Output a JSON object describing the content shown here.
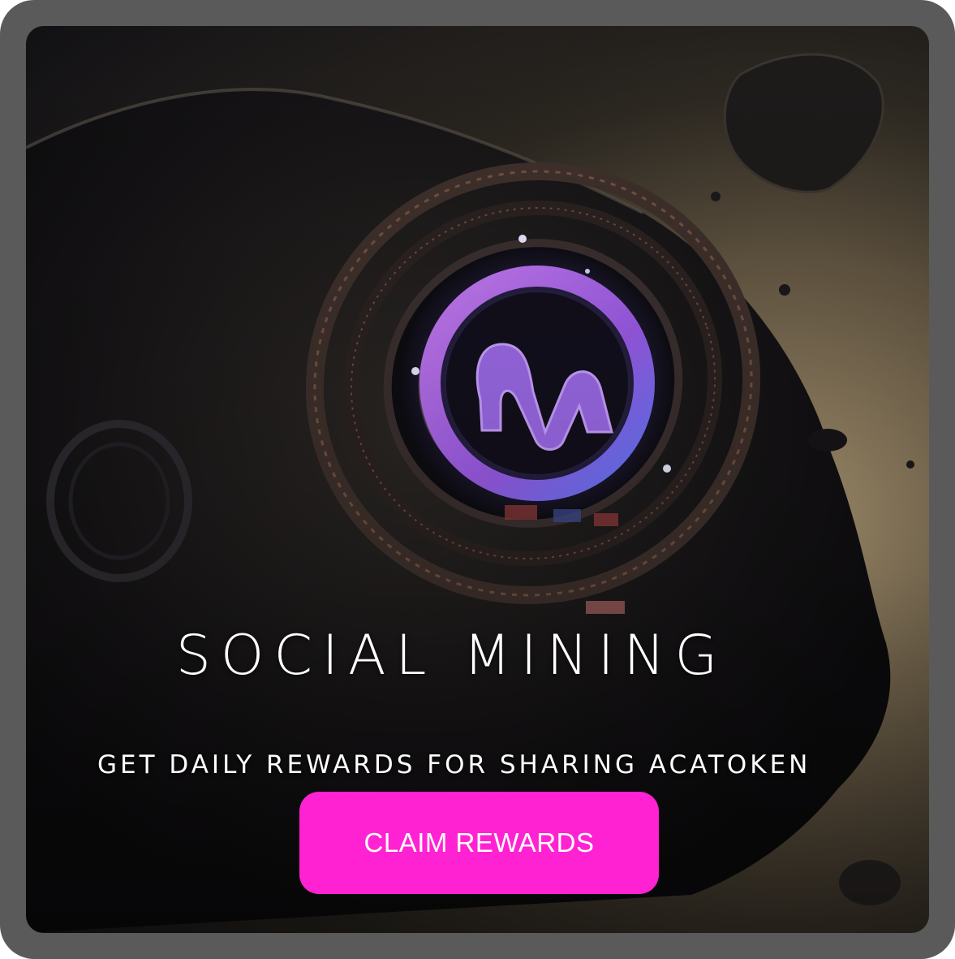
{
  "hero": {
    "title": "SOCIAL MINING",
    "subtitle": "GET DAILY REWARDS FOR SHARING ACATOKEN"
  },
  "cta": {
    "label": "CLAIM REWARDS"
  },
  "colors": {
    "frame": "#5a5a5a",
    "button": "#ff22d2",
    "logo_ring": "#a860ea",
    "logo_glow": "#6f7dff",
    "text": "#ffffff"
  },
  "icons": {
    "logo": "acatoken-w-logo"
  }
}
